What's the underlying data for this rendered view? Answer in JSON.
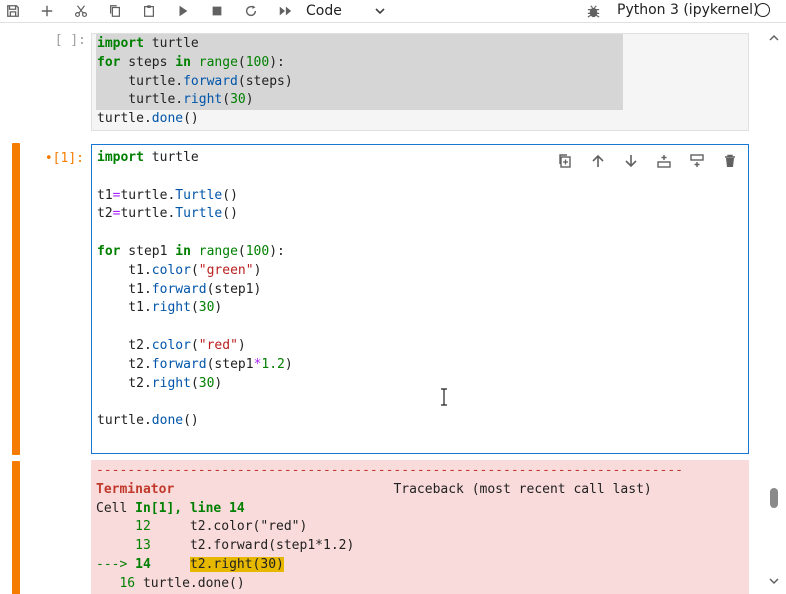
{
  "toolbar": {
    "buttons": [
      "save-icon",
      "add-icon",
      "cut-icon",
      "copy-icon",
      "paste-icon",
      "run-icon",
      "stop-icon",
      "restart-icon",
      "run-all-icon"
    ],
    "cell_type": "Code",
    "kernel_name": "Python 3 (ipykernel)"
  },
  "cell0": {
    "prompt": "[ ]:",
    "lines": [
      "import turtle",
      "for steps in range(100):",
      "    turtle.forward(steps)",
      "    turtle.right(30)",
      "turtle.done()"
    ]
  },
  "cell1": {
    "prompt": "•[1]:",
    "lines": [
      "import turtle",
      "",
      "t1=turtle.Turtle()",
      "t2=turtle.Turtle()",
      "",
      "for step1 in range(100):",
      "    t1.color(\"green\")",
      "    t1.forward(step1)",
      "    t1.right(30)",
      "",
      "    t2.color(\"red\")",
      "    t2.forward(step1*1.2)",
      "    t2.right(30)",
      "",
      "turtle.done()"
    ],
    "tools": [
      "duplicate-icon",
      "move-up-icon",
      "move-down-icon",
      "insert-below-icon",
      "insert-above-icon",
      "delete-icon"
    ]
  },
  "output": {
    "dashes": "---------------------------------------------------------------------------",
    "error_name": "Terminator",
    "traceback_label": "Traceback (most recent call last)",
    "cell_prefix": "Cell ",
    "cell_ref": "In[1], line 14",
    "rows": [
      {
        "marker": "     ",
        "num": "12",
        "code": "t2.color(\"red\")"
      },
      {
        "marker": "     ",
        "num": "13",
        "code": "t2.forward(step1*1.2)"
      },
      {
        "marker": "---> ",
        "num": "14",
        "code": "t2.right(30)"
      },
      {
        "marker": "     ",
        "num": "16",
        "code": "turtle.done()"
      }
    ]
  },
  "colors": {
    "accent": "#f57c00",
    "editor_border": "#1976d2",
    "error_bg": "#fadbdb"
  }
}
